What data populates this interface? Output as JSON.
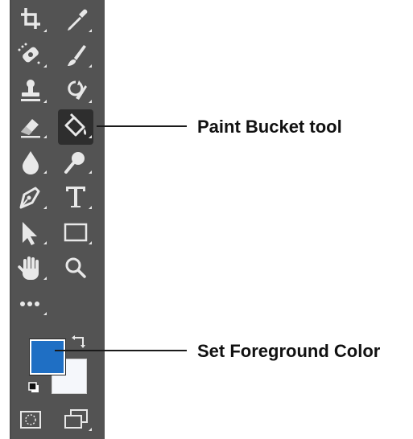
{
  "callouts": {
    "paint_bucket": "Paint Bucket tool",
    "foreground": "Set Foreground Color"
  },
  "tools": [
    [
      "crop-icon",
      "eyedropper-icon"
    ],
    [
      "spot-healing-icon",
      "brush-icon"
    ],
    [
      "clone-stamp-icon",
      "history-brush-icon"
    ],
    [
      "eraser-icon",
      "paint-bucket-icon"
    ],
    [
      "blur-icon",
      "dodge-icon"
    ],
    [
      "pen-icon",
      "type-icon"
    ],
    [
      "path-selection-icon",
      "rectangle-icon"
    ],
    [
      "hand-icon",
      "zoom-icon"
    ],
    [
      "more-tools-icon"
    ]
  ],
  "selected_tool": "paint-bucket-icon",
  "colors": {
    "toolbar_bg": "#535353",
    "icon": "#e8e8e8",
    "foreground_color": "#1f6fc4",
    "background_color": "#f5f7fb"
  }
}
